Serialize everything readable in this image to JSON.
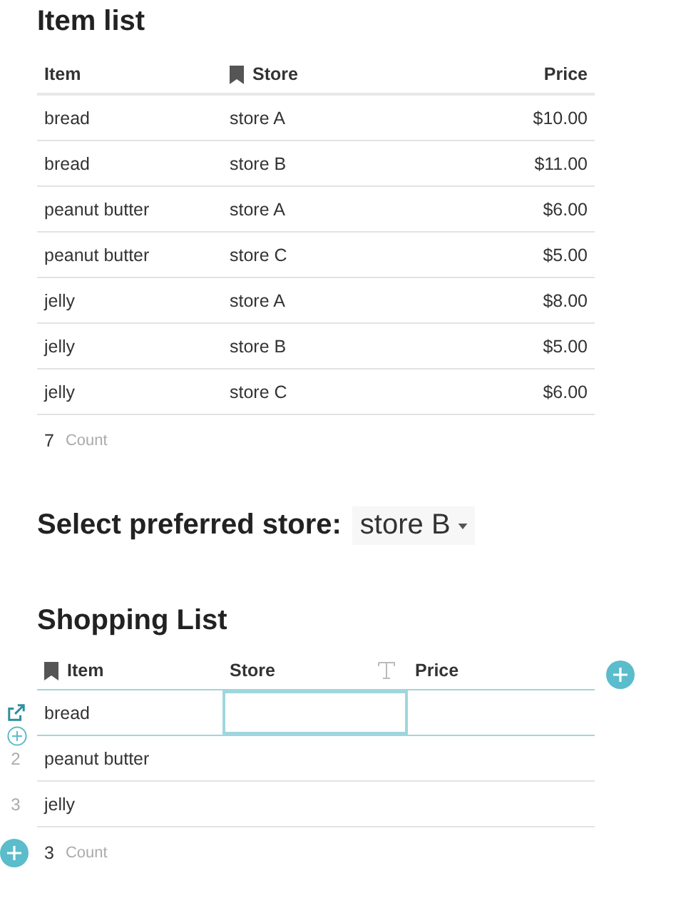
{
  "item_list": {
    "title": "Item list",
    "columns": [
      {
        "label": "Item",
        "kind": "plain"
      },
      {
        "label": "Store",
        "kind": "bookmark"
      },
      {
        "label": "Price",
        "kind": "numeric"
      }
    ],
    "rows": [
      {
        "cells": [
          "bread",
          "store A",
          "$10.00"
        ]
      },
      {
        "cells": [
          "bread",
          "store B",
          "$11.00"
        ]
      },
      {
        "cells": [
          "peanut butter",
          "store A",
          "$6.00"
        ]
      },
      {
        "cells": [
          "peanut butter",
          "store C",
          "$5.00"
        ]
      },
      {
        "cells": [
          "jelly",
          "store A",
          "$8.00"
        ]
      },
      {
        "cells": [
          "jelly",
          "store B",
          "$5.00"
        ]
      },
      {
        "cells": [
          "jelly",
          "store C",
          "$6.00"
        ]
      }
    ],
    "footer": {
      "count": "7",
      "label": "Count"
    }
  },
  "preferred_store": {
    "label": "Select preferred store:",
    "value": "store B"
  },
  "shopping_list": {
    "title": "Shopping List",
    "columns": [
      {
        "label": "Item",
        "kind": "bookmark"
      },
      {
        "label": "Store",
        "kind": "text"
      },
      {
        "label": "Price",
        "kind": "plain"
      }
    ],
    "rows": [
      {
        "hovered": true,
        "selected": true,
        "cells": [
          {
            "text": "bread",
            "focused": false
          },
          {
            "focused": true
          },
          {
            "focused": false
          }
        ]
      },
      {
        "number": "2",
        "hovered": false,
        "selected": false,
        "cells": [
          {
            "text": "peanut butter",
            "focused": false
          },
          {
            "focused": false
          },
          {
            "focused": false
          }
        ]
      },
      {
        "number": "3",
        "hovered": false,
        "selected": false,
        "cells": [
          {
            "text": "jelly",
            "focused": false
          },
          {
            "focused": false
          },
          {
            "focused": false
          }
        ]
      }
    ],
    "footer": {
      "count": "3",
      "label": "Count"
    }
  }
}
